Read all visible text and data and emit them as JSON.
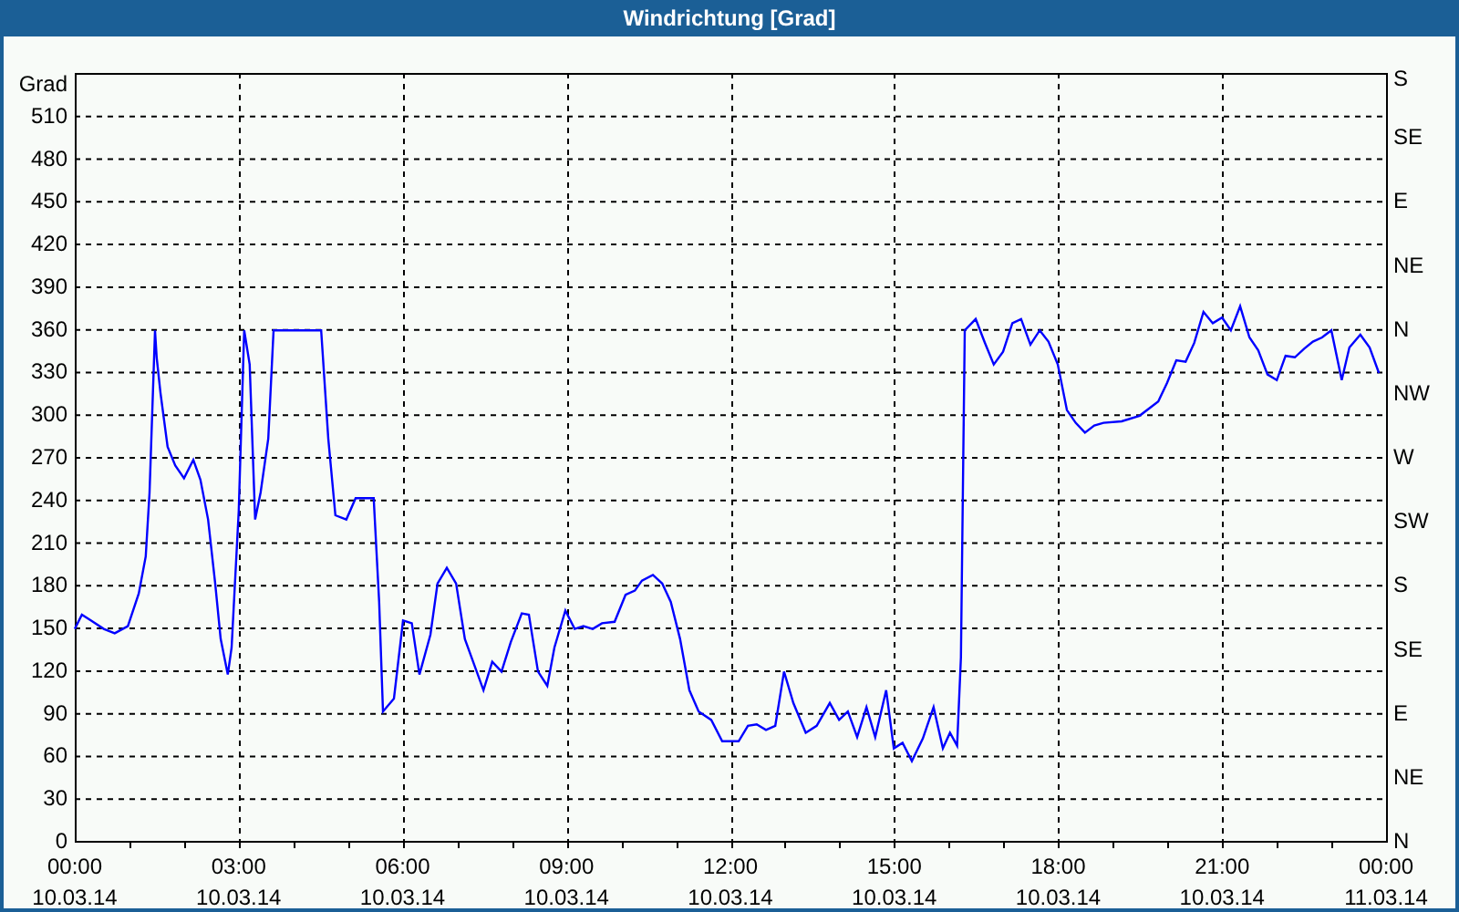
{
  "window": {
    "title": "Windrichtung [Grad]"
  },
  "chart": {
    "chart_data": {
      "type": "line",
      "ylabel": "Grad",
      "grid": true,
      "x": [
        0,
        0.13,
        0.3,
        0.53,
        0.73,
        0.97,
        1.17,
        1.3,
        1.37,
        1.47,
        1.5,
        1.57,
        1.7,
        1.84,
        2.0,
        2.17,
        2.3,
        2.44,
        2.57,
        2.67,
        2.8,
        2.87,
        3.0,
        3.1,
        3.2,
        3.3,
        3.4,
        3.54,
        3.64,
        4.51,
        4.64,
        4.77,
        4.97,
        5.14,
        5.47,
        5.57,
        5.64,
        5.84,
        6.01,
        6.17,
        6.31,
        6.51,
        6.64,
        6.81,
        6.98,
        7.14,
        7.48,
        7.64,
        7.81,
        7.98,
        8.18,
        8.31,
        8.48,
        8.65,
        8.78,
        8.98,
        9.15,
        9.31,
        9.48,
        9.65,
        9.88,
        10.08,
        10.25,
        10.38,
        10.58,
        10.75,
        10.91,
        11.08,
        11.25,
        11.42,
        11.65,
        11.85,
        12.15,
        12.32,
        12.48,
        12.65,
        12.82,
        12.98,
        13.15,
        13.38,
        13.58,
        13.82,
        13.99,
        14.15,
        14.32,
        14.49,
        14.65,
        14.85,
        14.99,
        15.15,
        15.32,
        15.52,
        15.72,
        15.89,
        16.02,
        16.15,
        16.22,
        16.29,
        16.49,
        16.66,
        16.82,
        16.99,
        17.16,
        17.32,
        17.49,
        17.66,
        17.82,
        17.99,
        18.16,
        18.32,
        18.49,
        18.66,
        18.83,
        19.16,
        19.49,
        19.83,
        19.99,
        20.16,
        20.33,
        20.49,
        20.66,
        20.83,
        21.0,
        21.16,
        21.33,
        21.5,
        21.66,
        21.83,
        22.0,
        22.16,
        22.33,
        22.5,
        22.66,
        22.83,
        23.0,
        23.19,
        23.33,
        23.53,
        23.7,
        23.87
      ],
      "series": [
        {
          "color": "#0000ff",
          "values": [
            149,
            159,
            155,
            149,
            146,
            151,
            174,
            200,
            245,
            359,
            340,
            315,
            277,
            264,
            255,
            268,
            254,
            226,
            181,
            142,
            117,
            136,
            232,
            359,
            335,
            226,
            245,
            283,
            359,
            359,
            283,
            229,
            226,
            241,
            241,
            168,
            91,
            100,
            155,
            153,
            117,
            145,
            181,
            192,
            181,
            142,
            106,
            126,
            119,
            140,
            160,
            159,
            119,
            109,
            136,
            162,
            149,
            151,
            149,
            153,
            154,
            173,
            176,
            183,
            187,
            181,
            168,
            142,
            106,
            91,
            85,
            70,
            70,
            81,
            82,
            78,
            81,
            119,
            97,
            76,
            81,
            97,
            85,
            91,
            73,
            94,
            73,
            106,
            65,
            69,
            56,
            72,
            94,
            65,
            76,
            67,
            129,
            359,
            367,
            350,
            335,
            344,
            364,
            367,
            349,
            359,
            351,
            335,
            303,
            294,
            287,
            292,
            294,
            295,
            299,
            309,
            322,
            338,
            337,
            350,
            372,
            364,
            368,
            359,
            376,
            354,
            345,
            328,
            324,
            341,
            340,
            346,
            351,
            354,
            359,
            324,
            347,
            356,
            347,
            329
          ]
        }
      ],
      "xlim": [
        0,
        24
      ],
      "ylim": [
        0,
        540
      ],
      "xticks": [
        {
          "value": 0,
          "label": "00:00"
        },
        {
          "value": 3,
          "label": "03:00"
        },
        {
          "value": 6,
          "label": "06:00"
        },
        {
          "value": 9,
          "label": "09:00"
        },
        {
          "value": 12,
          "label": "12:00"
        },
        {
          "value": 15,
          "label": "15:00"
        },
        {
          "value": 18,
          "label": "18:00"
        },
        {
          "value": 21,
          "label": "21:00"
        },
        {
          "value": 24,
          "label": "00:00"
        }
      ],
      "yticks": [
        0,
        30,
        60,
        90,
        120,
        150,
        180,
        210,
        240,
        270,
        300,
        330,
        360,
        390,
        420,
        450,
        480,
        510
      ]
    },
    "date_labels": [
      "10.03.14",
      "10.03.14",
      "10.03.14",
      "10.03.14",
      "10.03.14",
      "10.03.14",
      "10.03.14",
      "10.03.14",
      "11.03.14"
    ],
    "compass_labels": [
      "S",
      "SE",
      "E",
      "NE",
      "N",
      "NW",
      "W",
      "SW",
      "S",
      "SE",
      "E",
      "NE",
      "N"
    ]
  }
}
